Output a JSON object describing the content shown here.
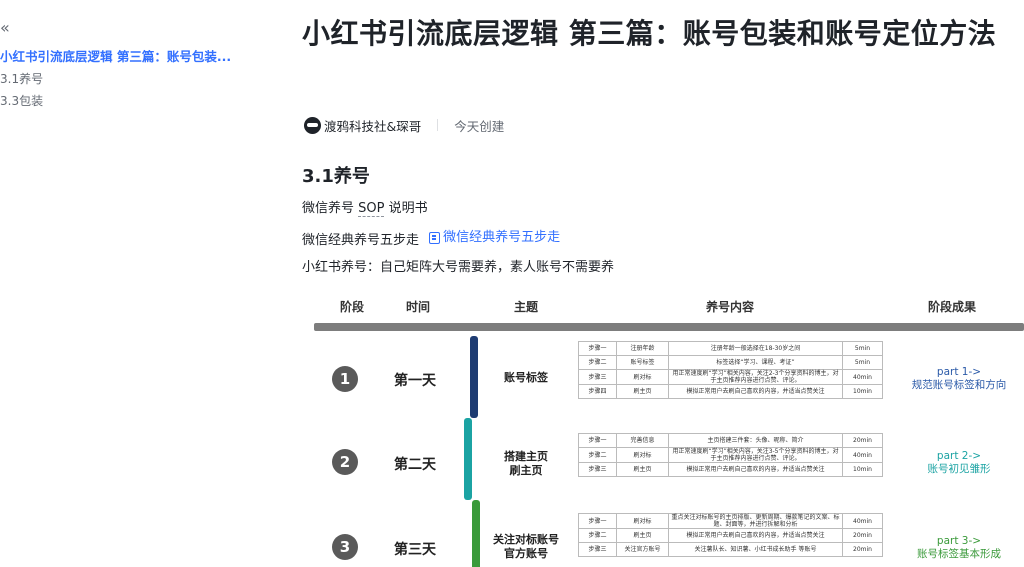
{
  "toc": {
    "collapse_glyph": "«",
    "items": [
      {
        "label": "小红书引流底层逻辑 第三篇：账号包装...",
        "active": true
      },
      {
        "label": "3.1养号",
        "active": false
      },
      {
        "label": "3.3包装",
        "active": false
      }
    ]
  },
  "doc": {
    "title": "小红书引流底层逻辑 第三篇：账号包装和账号定位方法",
    "author": "渡鸦科技社&琛哥",
    "created": "今天创建",
    "section_heading": "3.1养号",
    "p1_prefix": "微信养号 ",
    "p1_term": "SOP",
    "p1_suffix": " 说明书",
    "p2_text": "微信经典养号五步走",
    "p2_link": "微信经典养号五步走",
    "p3_text": "小红书养号：自己矩阵大号需要养，素人账号不需要养"
  },
  "image": {
    "headers": [
      "阶段",
      "时间",
      "主题",
      "养号内容",
      "阶段成果"
    ],
    "rows": [
      {
        "num": "1",
        "day": "第一天",
        "theme": "账号标签",
        "color": "#1e3c72",
        "result_line1": "part 1->",
        "result_line2": "规范账号标签和方向",
        "result_color": "#2b5aa8",
        "steps": [
          [
            "步骤一",
            "注册年龄",
            "注册年龄一般选择在18-30岁之间",
            "5min"
          ],
          [
            "步骤二",
            "账号标签",
            "标签选择“学习、课程、考证”",
            "5min"
          ],
          [
            "步骤三",
            "刷对标",
            "用正常速度刷“学习”相关内容，关注2-3个分享资料的博主，对于主页推荐内容进行点赞、评论。",
            "40min"
          ],
          [
            "步骤四",
            "刷主页",
            "模拟正常用户去刷自己喜欢的内容，并适当点赞关注",
            "10min"
          ]
        ]
      },
      {
        "num": "2",
        "day": "第二天",
        "theme": "搭建主页\n刷主页",
        "color": "#1ba3a3",
        "result_line1": "part 2->",
        "result_line2": "账号初见雏形",
        "result_color": "#1ba3a3",
        "steps": [
          [
            "步骤一",
            "完善信息",
            "主页搭建三件套：头像、昵称、简介",
            "20min"
          ],
          [
            "步骤二",
            "刷对标",
            "用正常速度刷“学习”相关内容，关注3-5个分享资料的博主，对于主页推荐内容进行点赞、评论。",
            "40min"
          ],
          [
            "步骤三",
            "刷主页",
            "模拟正常用户去刷自己喜欢的内容，并适当点赞关注",
            "10min"
          ]
        ]
      },
      {
        "num": "3",
        "day": "第三天",
        "theme": "关注对标账号\n官方账号",
        "color": "#3a9a3a",
        "result_line1": "part 3->",
        "result_line2": "账号标签基本形成",
        "result_color": "#3a9a3a",
        "steps": [
          [
            "步骤一",
            "刷对标",
            "重点关注对标账号的主页排版、更新周期、爆款笔记的文案、标题、封面等，并进行拆解和分析",
            "40min"
          ],
          [
            "步骤二",
            "刷主页",
            "模拟正常用户去刷自己喜欢的内容，并适当点赞关注",
            "20min"
          ],
          [
            "步骤三",
            "关注官方账号",
            "关注薯队长、知识薯、小红书成长助手 等账号",
            "20min"
          ]
        ]
      }
    ]
  }
}
